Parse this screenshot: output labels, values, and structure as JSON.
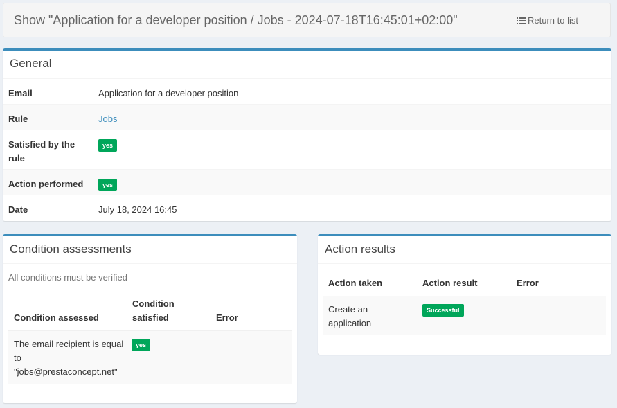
{
  "header": {
    "title": "Show \"Application for a developer position / Jobs - 2024-07-18T16:45:01+02:00\"",
    "return_label": "Return to list"
  },
  "general": {
    "title": "General",
    "email_label": "Email",
    "email_value": "Application for a developer position",
    "rule_label": "Rule",
    "rule_value": "Jobs",
    "satisfied_label": "Satisfied by the rule",
    "satisfied_value": "yes",
    "action_label": "Action performed",
    "action_value": "yes",
    "date_label": "Date",
    "date_value": "July 18, 2024 16:45"
  },
  "conditions": {
    "title": "Condition assessments",
    "hint": "All conditions must be verified",
    "columns": [
      "Condition assessed",
      "Condition satisfied",
      "Error"
    ],
    "rows": [
      {
        "condition": "The email recipient is equal to \"jobs@prestaconcept.net\"",
        "satisfied": "yes",
        "error": ""
      }
    ]
  },
  "actions": {
    "title": "Action results",
    "columns": [
      "Action taken",
      "Action result",
      "Error"
    ],
    "rows": [
      {
        "action": "Create an application",
        "result": "Successful",
        "error": ""
      }
    ]
  },
  "colors": {
    "accent": "#3c8dbc",
    "success": "#00a65a",
    "background": "#ecf0f5"
  }
}
